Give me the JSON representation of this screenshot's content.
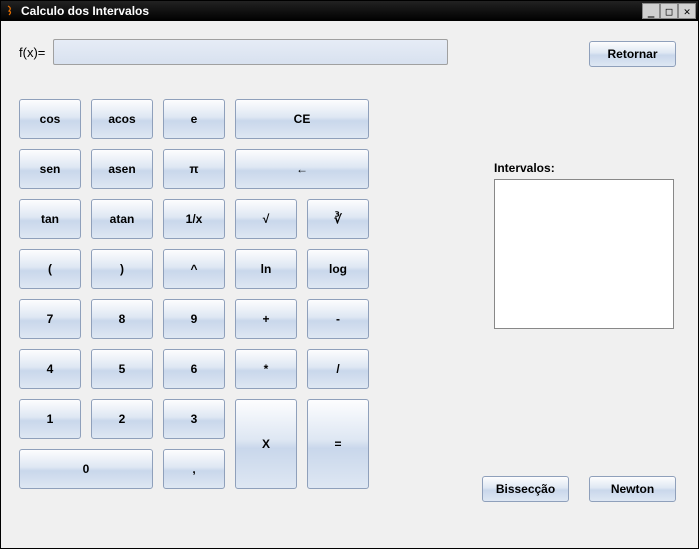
{
  "window": {
    "title": "Calculo dos Intervalos"
  },
  "fx": {
    "label": "f(x)=",
    "value": ""
  },
  "buttons": {
    "retornar": "Retornar",
    "bisseccao": "Bissecção",
    "newton": "Newton"
  },
  "intervals": {
    "label": "Intervalos:",
    "content": ""
  },
  "keys": {
    "cos": "cos",
    "acos": "acos",
    "e": "e",
    "ce": "CE",
    "sen": "sen",
    "asen": "asen",
    "pi": "π",
    "back": "←",
    "tan": "tan",
    "atan": "atan",
    "inv": "1/x",
    "sqrt": "√",
    "cbrt": "∛",
    "lpar": "(",
    "rpar": ")",
    "pow": "^",
    "ln": "ln",
    "log": "log",
    "n7": "7",
    "n8": "8",
    "n9": "9",
    "plus": "+",
    "minus": "-",
    "n4": "4",
    "n5": "5",
    "n6": "6",
    "mul": "*",
    "div": "/",
    "n1": "1",
    "n2": "2",
    "n3": "3",
    "n0": "0",
    "comma": ",",
    "x": "X",
    "eq": "="
  }
}
